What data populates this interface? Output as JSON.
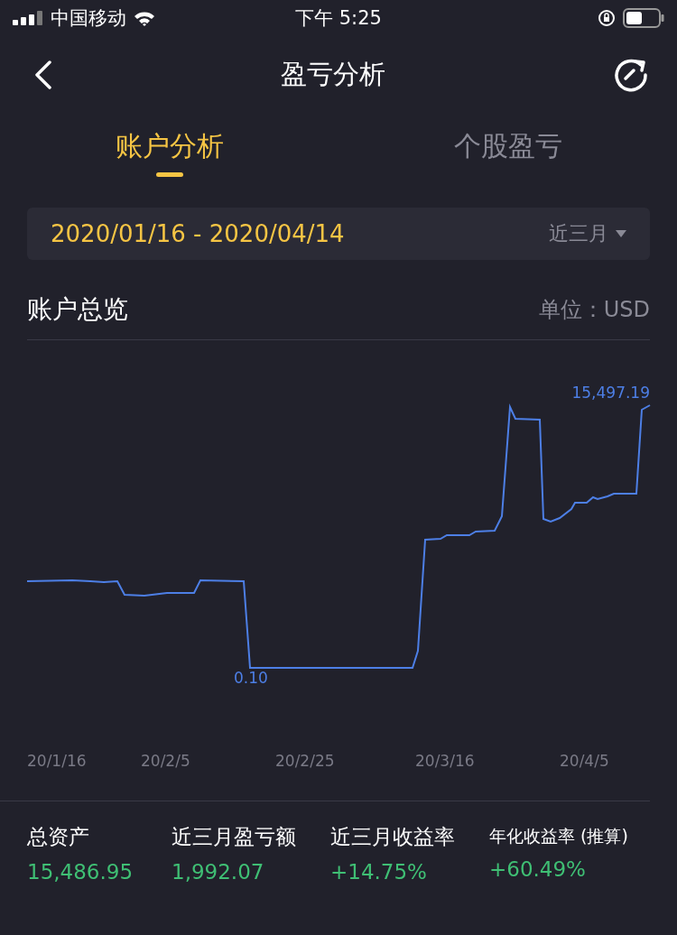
{
  "status_bar": {
    "carrier": "中国移动",
    "time": "下午 5:25"
  },
  "nav": {
    "title": "盈亏分析"
  },
  "tabs": [
    {
      "label": "账户分析",
      "selected": true
    },
    {
      "label": "个股盈亏",
      "selected": false
    }
  ],
  "date_range": {
    "value": "2020/01/16 - 2020/04/14",
    "period": "近三月"
  },
  "overview": {
    "title": "账户总览",
    "unit": "单位：USD",
    "chart": {
      "max_label": "15,497.19",
      "min_label": "0.10",
      "x_labels": [
        "20/1/16",
        "20/2/5",
        "20/2/25",
        "20/3/16",
        "20/4/5"
      ]
    }
  },
  "stats": [
    {
      "label": "总资产",
      "value": "15,486.95"
    },
    {
      "label": "近三月盈亏额",
      "value": "1,992.07"
    },
    {
      "label": "近三月收益率",
      "value": "+14.75%"
    },
    {
      "label": "年化收益率 (推算)",
      "value": "+60.49%"
    }
  ]
}
